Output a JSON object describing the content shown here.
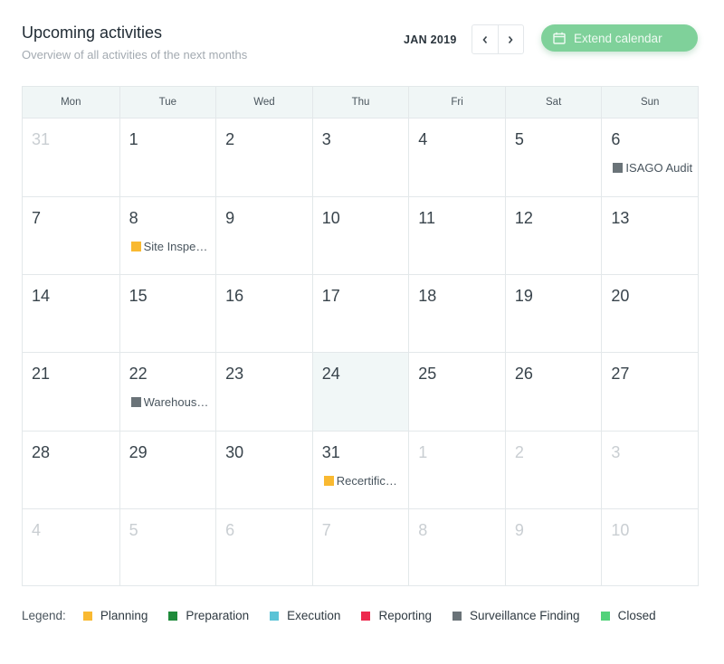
{
  "header": {
    "title": "Upcoming activities",
    "subtitle": "Overview of all activities of the next months"
  },
  "nav": {
    "month": "JAN 2019",
    "prev_icon": "chevron-left-icon",
    "next_icon": "chevron-right-icon"
  },
  "extend_button": {
    "label": "Extend calendar",
    "icon": "calendar-icon"
  },
  "calendar": {
    "weekdays": [
      "Mon",
      "Tue",
      "Wed",
      "Thu",
      "Fri",
      "Sat",
      "Sun"
    ],
    "today_day": "24",
    "days": [
      {
        "day": "31",
        "muted": true
      },
      {
        "day": "1"
      },
      {
        "day": "2"
      },
      {
        "day": "3"
      },
      {
        "day": "4"
      },
      {
        "day": "5"
      },
      {
        "day": "6",
        "event": {
          "label": "ISAGO Audit",
          "status": "Surveillance Finding"
        }
      },
      {
        "day": "7"
      },
      {
        "day": "8",
        "event": {
          "label": "Site Inspe…",
          "status": "Planning"
        }
      },
      {
        "day": "9"
      },
      {
        "day": "10"
      },
      {
        "day": "11"
      },
      {
        "day": "12"
      },
      {
        "day": "13"
      },
      {
        "day": "14"
      },
      {
        "day": "15"
      },
      {
        "day": "16"
      },
      {
        "day": "17"
      },
      {
        "day": "18"
      },
      {
        "day": "19"
      },
      {
        "day": "20"
      },
      {
        "day": "21"
      },
      {
        "day": "22",
        "event": {
          "label": "Warehous…",
          "status": "Surveillance Finding"
        }
      },
      {
        "day": "23"
      },
      {
        "day": "24",
        "today": true
      },
      {
        "day": "25"
      },
      {
        "day": "26"
      },
      {
        "day": "27"
      },
      {
        "day": "28"
      },
      {
        "day": "29"
      },
      {
        "day": "30"
      },
      {
        "day": "31",
        "event": {
          "label": "Recertific…",
          "status": "Planning"
        }
      },
      {
        "day": "1",
        "muted": true
      },
      {
        "day": "2",
        "muted": true
      },
      {
        "day": "3",
        "muted": true
      },
      {
        "day": "4",
        "muted": true
      },
      {
        "day": "5",
        "muted": true
      },
      {
        "day": "6",
        "muted": true
      },
      {
        "day": "7",
        "muted": true
      },
      {
        "day": "8",
        "muted": true
      },
      {
        "day": "9",
        "muted": true
      },
      {
        "day": "10",
        "muted": true
      }
    ]
  },
  "legend": {
    "title": "Legend:",
    "items": [
      {
        "label": "Planning",
        "color": "#f9b931"
      },
      {
        "label": "Preparation",
        "color": "#1f8b3b"
      },
      {
        "label": "Execution",
        "color": "#5bc3d6"
      },
      {
        "label": "Reporting",
        "color": "#ed2a4e"
      },
      {
        "label": "Surveillance Finding",
        "color": "#6a7378"
      },
      {
        "label": "Closed",
        "color": "#52d27a"
      }
    ]
  }
}
